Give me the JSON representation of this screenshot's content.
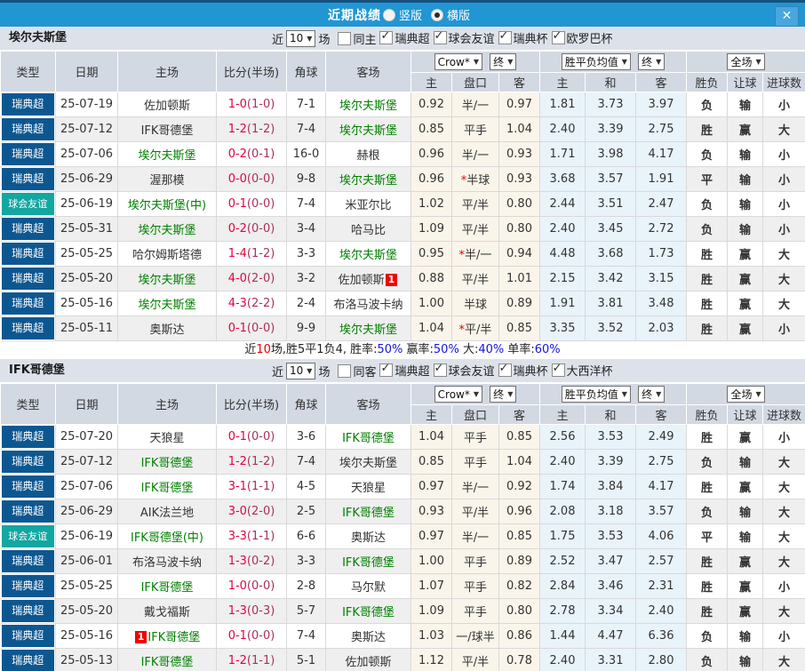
{
  "titlebar": {
    "title": "近期战绩",
    "vertical_label": "竖版",
    "horizontal_label": "横版",
    "selected_layout": "横版",
    "close_glyph": "✕"
  },
  "colors": {
    "titlebar_blue": "#2196d3",
    "league_navy": "#0d5791",
    "friendly_teal": "#12a7a0",
    "focus_team_green": "#008000",
    "win_red": "#d40000",
    "draw_blue": "#0a0ad2",
    "lose_green": "#007800",
    "score_red": "#e60040"
  },
  "table_header": {
    "type": "类型",
    "date": "日期",
    "home": "主场",
    "score": "比分(半场)",
    "corner": "角球",
    "away": "客场",
    "dd_company": "Crow*",
    "dd_final": "终",
    "dd_avg": "胜平负均值",
    "dd_final2": "终",
    "dd_scope": "全场",
    "sub_home": "主",
    "sub_handicap": "盘口",
    "sub_away": "客",
    "sub_win": "主",
    "sub_draw": "和",
    "sub_lose": "客",
    "sub_result": "胜负",
    "sub_let": "让球",
    "sub_goals": "进球数"
  },
  "sections": [
    {
      "team": "埃尔夫斯堡",
      "filters": {
        "prefix": "近",
        "count": "10",
        "suffix": "场",
        "same": {
          "label": "同主",
          "checked": false
        },
        "leagues": [
          {
            "label": "瑞典超",
            "checked": true
          },
          {
            "label": "球会友谊",
            "checked": true
          },
          {
            "label": "瑞典杯",
            "checked": true
          },
          {
            "label": "欧罗巴杯",
            "checked": true
          }
        ]
      },
      "rows": [
        {
          "type": "瑞典超",
          "date": "25-07-19",
          "home": "佐加顿斯",
          "home_focus": false,
          "home_badge": "",
          "score_ft": "1-0",
          "score_ht": "(1-0)",
          "corner": "7-1",
          "away": "埃尔夫斯堡",
          "away_focus": true,
          "away_badge": "",
          "crow_home": "0.92",
          "handicap": "半/一",
          "star": false,
          "crow_away": "0.97",
          "avg_home": "1.81",
          "avg_draw": "3.73",
          "avg_away": "3.97",
          "result": "负",
          "let_result": "输",
          "goal_result": "小"
        },
        {
          "type": "瑞典超",
          "date": "25-07-12",
          "home": "IFK哥德堡",
          "home_focus": false,
          "home_badge": "",
          "score_ft": "1-2",
          "score_ht": "(1-2)",
          "corner": "7-4",
          "away": "埃尔夫斯堡",
          "away_focus": true,
          "away_badge": "",
          "crow_home": "0.85",
          "handicap": "平手",
          "star": false,
          "crow_away": "1.04",
          "avg_home": "2.40",
          "avg_draw": "3.39",
          "avg_away": "2.75",
          "result": "胜",
          "let_result": "赢",
          "goal_result": "大"
        },
        {
          "type": "瑞典超",
          "date": "25-07-06",
          "home": "埃尔夫斯堡",
          "home_focus": true,
          "home_badge": "",
          "score_ft": "0-2",
          "score_ht": "(0-1)",
          "corner": "16-0",
          "away": "赫根",
          "away_focus": false,
          "away_badge": "",
          "crow_home": "0.96",
          "handicap": "半/一",
          "star": false,
          "crow_away": "0.93",
          "avg_home": "1.71",
          "avg_draw": "3.98",
          "avg_away": "4.17",
          "result": "负",
          "let_result": "输",
          "goal_result": "小"
        },
        {
          "type": "瑞典超",
          "date": "25-06-29",
          "home": "渥那模",
          "home_focus": false,
          "home_badge": "",
          "score_ft": "0-0",
          "score_ht": "(0-0)",
          "corner": "9-8",
          "away": "埃尔夫斯堡",
          "away_focus": true,
          "away_badge": "",
          "crow_home": "0.96",
          "handicap": "半球",
          "star": true,
          "crow_away": "0.93",
          "avg_home": "3.68",
          "avg_draw": "3.57",
          "avg_away": "1.91",
          "result": "平",
          "let_result": "输",
          "goal_result": "小"
        },
        {
          "type": "球会友谊",
          "date": "25-06-19",
          "home": "埃尔夫斯堡(中)",
          "home_focus": true,
          "home_badge": "",
          "score_ft": "0-1",
          "score_ht": "(0-0)",
          "corner": "7-4",
          "away": "米亚尔比",
          "away_focus": false,
          "away_badge": "",
          "crow_home": "1.02",
          "handicap": "平/半",
          "star": false,
          "crow_away": "0.80",
          "avg_home": "2.44",
          "avg_draw": "3.51",
          "avg_away": "2.47",
          "result": "负",
          "let_result": "输",
          "goal_result": "小"
        },
        {
          "type": "瑞典超",
          "date": "25-05-31",
          "home": "埃尔夫斯堡",
          "home_focus": true,
          "home_badge": "",
          "score_ft": "0-2",
          "score_ht": "(0-0)",
          "corner": "3-4",
          "away": "哈马比",
          "away_focus": false,
          "away_badge": "",
          "crow_home": "1.09",
          "handicap": "平/半",
          "star": false,
          "crow_away": "0.80",
          "avg_home": "2.40",
          "avg_draw": "3.45",
          "avg_away": "2.72",
          "result": "负",
          "let_result": "输",
          "goal_result": "小"
        },
        {
          "type": "瑞典超",
          "date": "25-05-25",
          "home": "哈尔姆斯塔德",
          "home_focus": false,
          "home_badge": "",
          "score_ft": "1-4",
          "score_ht": "(1-2)",
          "corner": "3-3",
          "away": "埃尔夫斯堡",
          "away_focus": true,
          "away_badge": "",
          "crow_home": "0.95",
          "handicap": "半/一",
          "star": true,
          "crow_away": "0.94",
          "avg_home": "4.48",
          "avg_draw": "3.68",
          "avg_away": "1.73",
          "result": "胜",
          "let_result": "赢",
          "goal_result": "大"
        },
        {
          "type": "瑞典超",
          "date": "25-05-20",
          "home": "埃尔夫斯堡",
          "home_focus": true,
          "home_badge": "",
          "score_ft": "4-0",
          "score_ht": "(2-0)",
          "corner": "3-2",
          "away": "佐加顿斯",
          "away_focus": false,
          "away_badge": "1",
          "crow_home": "0.88",
          "handicap": "平/半",
          "star": false,
          "crow_away": "1.01",
          "avg_home": "2.15",
          "avg_draw": "3.42",
          "avg_away": "3.15",
          "result": "胜",
          "let_result": "赢",
          "goal_result": "大"
        },
        {
          "type": "瑞典超",
          "date": "25-05-16",
          "home": "埃尔夫斯堡",
          "home_focus": true,
          "home_badge": "",
          "score_ft": "4-3",
          "score_ht": "(2-2)",
          "corner": "2-4",
          "away": "布洛马波卡纳",
          "away_focus": false,
          "away_badge": "",
          "crow_home": "1.00",
          "handicap": "半球",
          "star": false,
          "crow_away": "0.89",
          "avg_home": "1.91",
          "avg_draw": "3.81",
          "avg_away": "3.48",
          "result": "胜",
          "let_result": "赢",
          "goal_result": "大"
        },
        {
          "type": "瑞典超",
          "date": "25-05-11",
          "home": "奥斯达",
          "home_focus": false,
          "home_badge": "",
          "score_ft": "0-1",
          "score_ht": "(0-0)",
          "corner": "9-9",
          "away": "埃尔夫斯堡",
          "away_focus": true,
          "away_badge": "",
          "crow_home": "1.04",
          "handicap": "平/半",
          "star": true,
          "crow_away": "0.85",
          "avg_home": "3.35",
          "avg_draw": "3.52",
          "avg_away": "2.03",
          "result": "胜",
          "let_result": "赢",
          "goal_result": "小"
        }
      ],
      "summary": [
        {
          "t": "近",
          "c": "k"
        },
        {
          "t": "10",
          "c": "r"
        },
        {
          "t": "场,胜5平1负4, 胜率:",
          "c": "k"
        },
        {
          "t": "50%",
          "c": "b"
        },
        {
          "t": " 赢率:",
          "c": "k"
        },
        {
          "t": "50%",
          "c": "b"
        },
        {
          "t": " 大:",
          "c": "k"
        },
        {
          "t": "40%",
          "c": "b"
        },
        {
          "t": " 单率:",
          "c": "k"
        },
        {
          "t": "60%",
          "c": "b"
        }
      ]
    },
    {
      "team": "IFK哥德堡",
      "filters": {
        "prefix": "近",
        "count": "10",
        "suffix": "场",
        "same": {
          "label": "同客",
          "checked": false
        },
        "leagues": [
          {
            "label": "瑞典超",
            "checked": true
          },
          {
            "label": "球会友谊",
            "checked": true
          },
          {
            "label": "瑞典杯",
            "checked": true
          },
          {
            "label": "大西洋杯",
            "checked": true
          }
        ]
      },
      "rows": [
        {
          "type": "瑞典超",
          "date": "25-07-20",
          "home": "天狼星",
          "home_focus": false,
          "home_badge": "",
          "score_ft": "0-1",
          "score_ht": "(0-0)",
          "corner": "3-6",
          "away": "IFK哥德堡",
          "away_focus": true,
          "away_badge": "",
          "crow_home": "1.04",
          "handicap": "平手",
          "star": false,
          "crow_away": "0.85",
          "avg_home": "2.56",
          "avg_draw": "3.53",
          "avg_away": "2.49",
          "result": "胜",
          "let_result": "赢",
          "goal_result": "小"
        },
        {
          "type": "瑞典超",
          "date": "25-07-12",
          "home": "IFK哥德堡",
          "home_focus": true,
          "home_badge": "",
          "score_ft": "1-2",
          "score_ht": "(1-2)",
          "corner": "7-4",
          "away": "埃尔夫斯堡",
          "away_focus": false,
          "away_badge": "",
          "crow_home": "0.85",
          "handicap": "平手",
          "star": false,
          "crow_away": "1.04",
          "avg_home": "2.40",
          "avg_draw": "3.39",
          "avg_away": "2.75",
          "result": "负",
          "let_result": "输",
          "goal_result": "大"
        },
        {
          "type": "瑞典超",
          "date": "25-07-06",
          "home": "IFK哥德堡",
          "home_focus": true,
          "home_badge": "",
          "score_ft": "3-1",
          "score_ht": "(1-1)",
          "corner": "4-5",
          "away": "天狼星",
          "away_focus": false,
          "away_badge": "",
          "crow_home": "0.97",
          "handicap": "半/一",
          "star": false,
          "crow_away": "0.92",
          "avg_home": "1.74",
          "avg_draw": "3.84",
          "avg_away": "4.17",
          "result": "胜",
          "let_result": "赢",
          "goal_result": "大"
        },
        {
          "type": "瑞典超",
          "date": "25-06-29",
          "home": "AIK法兰地",
          "home_focus": false,
          "home_badge": "",
          "score_ft": "3-0",
          "score_ht": "(2-0)",
          "corner": "2-5",
          "away": "IFK哥德堡",
          "away_focus": true,
          "away_badge": "",
          "crow_home": "0.93",
          "handicap": "平/半",
          "star": false,
          "crow_away": "0.96",
          "avg_home": "2.08",
          "avg_draw": "3.18",
          "avg_away": "3.57",
          "result": "负",
          "let_result": "输",
          "goal_result": "大"
        },
        {
          "type": "球会友谊",
          "date": "25-06-19",
          "home": "IFK哥德堡(中)",
          "home_focus": true,
          "home_badge": "",
          "score_ft": "3-3",
          "score_ht": "(1-1)",
          "corner": "6-6",
          "away": "奥斯达",
          "away_focus": false,
          "away_badge": "",
          "crow_home": "0.97",
          "handicap": "半/一",
          "star": false,
          "crow_away": "0.85",
          "avg_home": "1.75",
          "avg_draw": "3.53",
          "avg_away": "4.06",
          "result": "平",
          "let_result": "输",
          "goal_result": "大"
        },
        {
          "type": "瑞典超",
          "date": "25-06-01",
          "home": "布洛马波卡纳",
          "home_focus": false,
          "home_badge": "",
          "score_ft": "1-3",
          "score_ht": "(0-2)",
          "corner": "3-3",
          "away": "IFK哥德堡",
          "away_focus": true,
          "away_badge": "",
          "crow_home": "1.00",
          "handicap": "平手",
          "star": false,
          "crow_away": "0.89",
          "avg_home": "2.52",
          "avg_draw": "3.47",
          "avg_away": "2.57",
          "result": "胜",
          "let_result": "赢",
          "goal_result": "大"
        },
        {
          "type": "瑞典超",
          "date": "25-05-25",
          "home": "IFK哥德堡",
          "home_focus": true,
          "home_badge": "",
          "score_ft": "1-0",
          "score_ht": "(0-0)",
          "corner": "2-8",
          "away": "马尔默",
          "away_focus": false,
          "away_badge": "",
          "crow_home": "1.07",
          "handicap": "平手",
          "star": false,
          "crow_away": "0.82",
          "avg_home": "2.84",
          "avg_draw": "3.46",
          "avg_away": "2.31",
          "result": "胜",
          "let_result": "赢",
          "goal_result": "小"
        },
        {
          "type": "瑞典超",
          "date": "25-05-20",
          "home": "戴戈福斯",
          "home_focus": false,
          "home_badge": "",
          "score_ft": "1-3",
          "score_ht": "(0-3)",
          "corner": "5-7",
          "away": "IFK哥德堡",
          "away_focus": true,
          "away_badge": "",
          "crow_home": "1.09",
          "handicap": "平手",
          "star": false,
          "crow_away": "0.80",
          "avg_home": "2.78",
          "avg_draw": "3.34",
          "avg_away": "2.40",
          "result": "胜",
          "let_result": "赢",
          "goal_result": "大"
        },
        {
          "type": "瑞典超",
          "date": "25-05-16",
          "home": "IFK哥德堡",
          "home_focus": true,
          "home_badge": "1",
          "score_ft": "0-1",
          "score_ht": "(0-0)",
          "corner": "7-4",
          "away": "奥斯达",
          "away_focus": false,
          "away_badge": "",
          "crow_home": "1.03",
          "handicap": "一/球半",
          "star": false,
          "crow_away": "0.86",
          "avg_home": "1.44",
          "avg_draw": "4.47",
          "avg_away": "6.36",
          "result": "负",
          "let_result": "输",
          "goal_result": "小"
        },
        {
          "type": "瑞典超",
          "date": "25-05-13",
          "home": "IFK哥德堡",
          "home_focus": true,
          "home_badge": "",
          "score_ft": "1-2",
          "score_ht": "(1-1)",
          "corner": "5-1",
          "away": "佐加顿斯",
          "away_focus": false,
          "away_badge": "",
          "crow_home": "1.12",
          "handicap": "平/半",
          "star": false,
          "crow_away": "0.78",
          "avg_home": "2.40",
          "avg_draw": "3.31",
          "avg_away": "2.80",
          "result": "负",
          "let_result": "输",
          "goal_result": "大"
        }
      ],
      "summary": []
    }
  ]
}
